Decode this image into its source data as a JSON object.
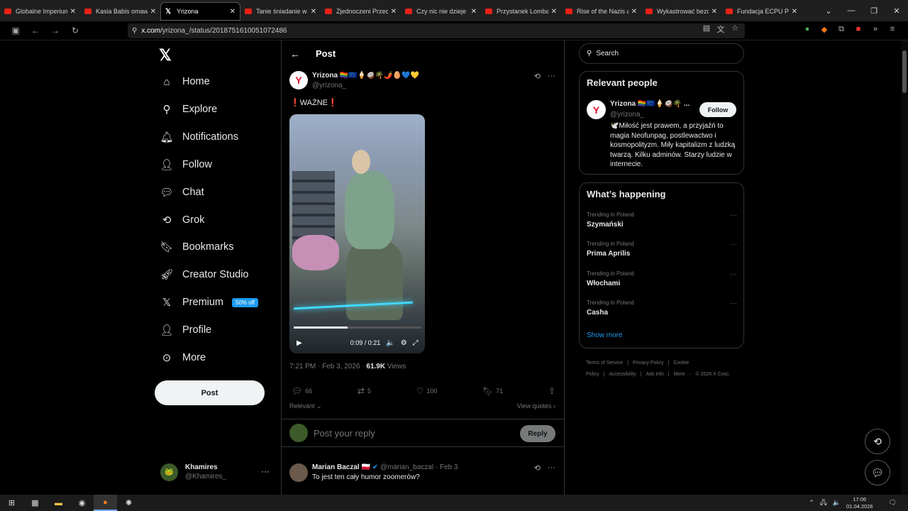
{
  "browser": {
    "tabs": [
      {
        "title": "Globalne Imperium B",
        "icon": "youtube-icon"
      },
      {
        "title": "Kasia Babis omawia",
        "icon": "youtube-icon"
      },
      {
        "title": "Yrizona",
        "icon": "x-icon",
        "active": true
      },
      {
        "title": "Tanie śniadanie w pie",
        "icon": "youtube-icon"
      },
      {
        "title": "Zjednoczeni Przeciw",
        "icon": "youtube-icon"
      },
      {
        "title": "Czy nic nie dzieje się",
        "icon": "youtube-icon"
      },
      {
        "title": "Przystanek Lombard",
        "icon": "youtube-icon"
      },
      {
        "title": "Rise of the Nazis and",
        "icon": "youtube-icon"
      },
      {
        "title": "Wykastrować bezdom",
        "icon": "youtube-icon"
      },
      {
        "title": "Fundacja ECPU Polsk",
        "icon": "youtube-icon"
      }
    ],
    "url_host": "x.com",
    "url_path": "/yrizona_/status/2018751610051072486"
  },
  "sidebar": {
    "items": [
      {
        "label": "Home",
        "icon": "home-icon"
      },
      {
        "label": "Explore",
        "icon": "search-icon"
      },
      {
        "label": "Notifications",
        "icon": "bell-icon"
      },
      {
        "label": "Follow",
        "icon": "add-person-icon"
      },
      {
        "label": "Chat",
        "icon": "chat-icon"
      },
      {
        "label": "Grok",
        "icon": "grok-icon"
      },
      {
        "label": "Bookmarks",
        "icon": "bookmark-icon"
      },
      {
        "label": "Creator Studio",
        "icon": "rocket-icon"
      },
      {
        "label": "Premium",
        "icon": "x-logo-icon"
      },
      {
        "label": "Profile",
        "icon": "person-icon"
      },
      {
        "label": "More",
        "icon": "more-circle-icon"
      }
    ],
    "premium_badge": "50% off",
    "post_button": "Post",
    "account": {
      "name": "Khamires",
      "handle": "@Khamires_"
    }
  },
  "post": {
    "header_title": "Post",
    "author_name": "Yrizona 🏳️‍🌈🇪🇺🍦🥥🌴🌶️🥚💙💛",
    "author_handle": "@yrizona_",
    "text_word": "WAŻNE",
    "video_time": "0:09 / 0:21",
    "video_progress": 0.42,
    "timestamp": "7:21 PM · Feb 3, 2026 · ",
    "views_count": "61.9K",
    "views_label": " Views",
    "stats": {
      "replies": "66",
      "reposts": "5",
      "likes": "100",
      "bookmarks": "71"
    },
    "sort_label": "Relevant",
    "view_quotes": "View quotes",
    "reply_placeholder": "Post your reply",
    "reply_button": "Reply"
  },
  "reply": {
    "name": "Marian Baczal",
    "handle": "@marian_baczal",
    "date": "Feb 3",
    "text": "To jest ten cały humor zoomerów?"
  },
  "right": {
    "search_placeholder": "Search",
    "relevant_title": "Relevant people",
    "person": {
      "name": "Yrizona 🏳️‍🌈🇪🇺🍦🥥🌴 ...",
      "handle": "@yrizona_",
      "follow": "Follow",
      "bio": "🕊️Miłość jest prawem, a przyjaźń to magia Neofunpag, postlewactwo i kosmopolityzm. Miły kapitalizm z ludzką twarzą. Kilku adminów. Starzy ludzie w internecie."
    },
    "happening_title": "What’s happening",
    "trends": [
      {
        "context": "Trending in Poland",
        "name": "Szymański"
      },
      {
        "context": "Trending in Poland",
        "name": "Prima Aprilis"
      },
      {
        "context": "Trending in Poland",
        "name": "Włochami"
      },
      {
        "context": "Trending in Poland",
        "name": "Casha"
      }
    ],
    "show_more": "Show more",
    "footer": [
      "Terms of Service",
      "|",
      "Privacy Policy",
      "|",
      "Cookie Policy",
      "|",
      "Accessibility",
      "|",
      "Ads info",
      "|",
      "More ···",
      "© 2026 X Corp."
    ]
  },
  "taskbar": {
    "time": "17:06",
    "date": "01.04.2026"
  }
}
